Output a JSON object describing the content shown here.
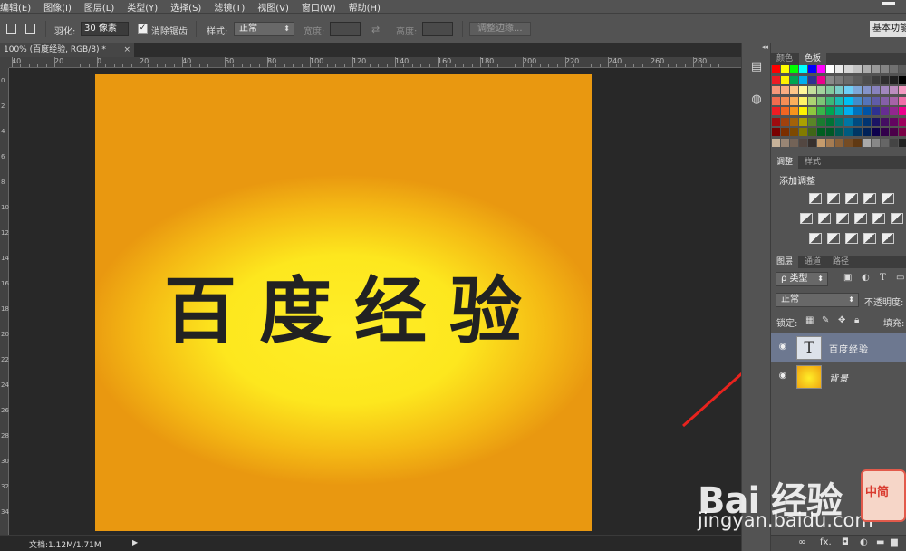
{
  "menu": [
    "编辑(E)",
    "图像(I)",
    "图层(L)",
    "类型(Y)",
    "选择(S)",
    "滤镜(T)",
    "视图(V)",
    "窗口(W)",
    "帮助(H)"
  ],
  "options_bar": {
    "feather_label": "羽化:",
    "feather_value": "30 像素",
    "antialias_label": "消除锯齿",
    "antialias_checked": "✓",
    "style_label": "样式:",
    "style_value": "正常",
    "width_label": "宽度:",
    "height_label": "高度:",
    "refine_button": "调整边缘...",
    "workspace_button": "基本功能"
  },
  "document": {
    "tab_title": "100% (百度经验, RGB/8) *",
    "close": "×",
    "canvas_text": "百度经验",
    "status": "文档:1.12M/1.71M",
    "status_arrow": "▶"
  },
  "ruler": {
    "top_labels": [
      "40",
      "20",
      "0",
      "20",
      "40",
      "60",
      "80",
      "100",
      "120",
      "140",
      "160",
      "180",
      "200",
      "220",
      "240",
      "260",
      "280"
    ],
    "left_labels": [
      "0",
      "2",
      "4",
      "6",
      "8",
      "10",
      "12",
      "14",
      "16",
      "18",
      "20",
      "22",
      "24",
      "26",
      "28",
      "30",
      "32",
      "34"
    ]
  },
  "panels": {
    "color_tabs": [
      "颜色",
      "色板"
    ],
    "adjust_tabs": [
      "调整",
      "样式"
    ],
    "adjust_title": "添加调整",
    "layers_tabs": [
      "图层",
      "通道",
      "路径"
    ],
    "kind_filter": "ρ 类型",
    "blend_mode": "正常",
    "opacity_label": "不透明度:",
    "lock_label": "锁定:",
    "fill_label": "填充:",
    "layers": [
      {
        "name": "百度经验",
        "type": "text",
        "thumb": "T"
      },
      {
        "name": "背景",
        "type": "background"
      }
    ],
    "bottom_icons": [
      "∞",
      "fx.",
      "◘",
      "◐",
      "▬",
      "▆",
      "▤"
    ]
  },
  "watermark": {
    "logo": "Bai  经验",
    "url": "jingyan.baidu.com",
    "stamp": "中简"
  },
  "colors": {
    "accent_arrow": "#e8231e",
    "canvas_orange": "#e99810",
    "canvas_yellow": "#ffee28",
    "selected_layer": "#6d7890"
  }
}
